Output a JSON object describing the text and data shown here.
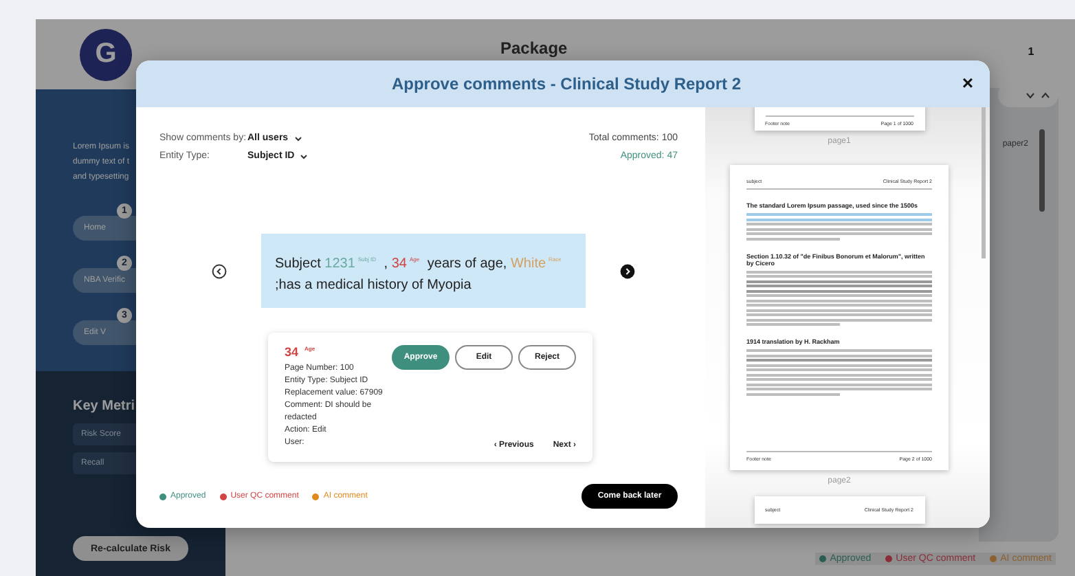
{
  "background": {
    "logo_letter": "G",
    "sidebar_text": [
      "Lorem Ipsum is",
      "dummy text of t",
      "and typesetting"
    ],
    "steps": [
      {
        "number": "1",
        "label": "Home"
      },
      {
        "number": "2",
        "label": "NBA Verific"
      },
      {
        "number": "3",
        "label": "Edit V"
      }
    ],
    "key_metrics": {
      "title": "Key Metri",
      "items": [
        "Risk Score",
        "Recall"
      ]
    },
    "recalculate_button": "Re-calculate Risk",
    "page_title": "Package",
    "page_badge": "1",
    "page_label": "paper2",
    "legend": [
      {
        "label": "Approved",
        "color": "#2b5e52"
      },
      {
        "label": "User QC comment",
        "color": "#8a2d38"
      },
      {
        "label": "AI comment",
        "color": "#8c6030"
      }
    ]
  },
  "modal": {
    "title": "Approve comments - Clinical Study Report 2",
    "close": "×",
    "filters": [
      {
        "label": "Show comments by:",
        "value": "All users"
      },
      {
        "label": "Entity Type:",
        "value": "Subject ID"
      }
    ],
    "total_comments": "Total comments: 100",
    "approved": "Approved: 47",
    "sentence": [
      {
        "kind": "plain",
        "text": "Subject "
      },
      {
        "kind": "entity",
        "text": "1231",
        "tag": "Subj ID",
        "color": "#6aa9a0"
      },
      {
        "kind": "plain",
        "text": " , "
      },
      {
        "kind": "entity",
        "text": "34",
        "tag": "Age",
        "color": "#d04444"
      },
      {
        "kind": "plain",
        "text": " years of age, "
      },
      {
        "kind": "entity",
        "text": "White",
        "tag": "Race",
        "color": "#d4a060"
      },
      {
        "kind": "plain",
        "text": " ;has a medical history of Myopia"
      }
    ],
    "comment": {
      "value": "34",
      "tag": "Age",
      "details": [
        "Page Number: 100",
        "Entity Type: Subject ID",
        "Replacement value: 67909",
        "Comment: DI should be redacted",
        "Action: Edit",
        "User:"
      ],
      "actions": [
        {
          "label": "Approve",
          "kind": "primary"
        },
        {
          "label": "Edit",
          "kind": "outline"
        },
        {
          "label": "Reject",
          "kind": "outline"
        }
      ],
      "previous": "‹ Previous",
      "next": "Next ›"
    },
    "legend": [
      {
        "label": "Approved",
        "color": "#3f8f7f"
      },
      {
        "label": "User QC comment",
        "color": "#d04444"
      },
      {
        "label": "AI comment",
        "color": "#e08a1e"
      }
    ],
    "come_back_button": "Come back later",
    "preview": {
      "pages": [
        {
          "kind": "bottom",
          "footer_left": "Footer note",
          "footer_right": "Page 1 of 1000",
          "label": "page1"
        },
        {
          "kind": "full",
          "header_left": "subject",
          "header_right": "Clinical Study Report 2",
          "sections": [
            "The standard Lorem Ipsum passage, used since the 1500s",
            "Section 1.10.32 of \"de Finibus Bonorum et Malorum\", written by Cicero",
            "1914 translation by H. Rackham"
          ],
          "footer_left": "Footer note",
          "footer_right": "Page 2 of 1000",
          "label": "page2"
        },
        {
          "kind": "top",
          "header_left": "subject",
          "header_right": "Clinical Study Report 2"
        }
      ]
    }
  }
}
